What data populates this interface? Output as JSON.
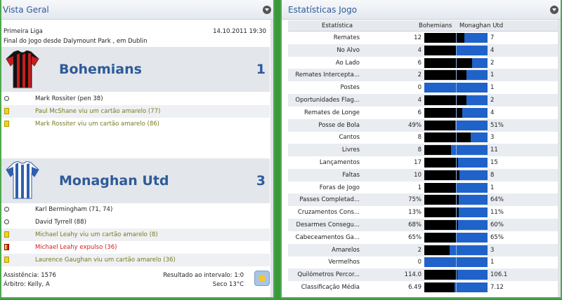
{
  "left": {
    "title": "Vista Geral",
    "competition": "Primeira Liga",
    "datetime": "14.10.2011 19:30",
    "match_status": "Final do Jogo desde Dalymount Park , em Dublin",
    "home": {
      "name": "Bohemians",
      "score": "1",
      "shirt_colors": [
        "#111111",
        "#c41e1e"
      ]
    },
    "home_events": [
      {
        "icon": "ball",
        "text": "Mark Rossiter (pen 38)",
        "color": "gray"
      },
      {
        "icon": "yellow",
        "text": "Paul McShane viu um cartão amarelo (77)",
        "color": "olive"
      },
      {
        "icon": "yellow",
        "text": "Mark Rossiter viu um cartão amarelo (86)",
        "color": "olive"
      }
    ],
    "away": {
      "name": "Monaghan Utd",
      "score": "3",
      "shirt_colors": [
        "#2e5fb0",
        "#ffffff"
      ]
    },
    "away_events": [
      {
        "icon": "ball",
        "text": "Karl Bermingham (71, 74)",
        "color": "gray"
      },
      {
        "icon": "ball",
        "text": "David Tyrrell (88)",
        "color": "gray"
      },
      {
        "icon": "yellow",
        "text": "Michael Leahy viu um cartão amarelo (8)",
        "color": "olive"
      },
      {
        "icon": "red",
        "text": "Michael Leahy expulso (36)",
        "color": "red"
      },
      {
        "icon": "yellow",
        "text": "Laurence Gaughan viu um cartão amarelo (36)",
        "color": "olive"
      }
    ],
    "attendance": "Assistência: 1576",
    "referee": "Árbitro: Kelly, A",
    "halftime": "Resultado ao intervalo: 1:0",
    "weather": "Seco 13°C"
  },
  "right": {
    "title": "Estatísticas Jogo",
    "col_stat": "Estatística",
    "col_home": "Bohemians",
    "col_away": "Monaghan Utd",
    "stats": [
      {
        "label": "Remates",
        "home": "12",
        "away": "7",
        "share": 0.63
      },
      {
        "label": "No Alvo",
        "home": "4",
        "away": "4",
        "share": 0.5
      },
      {
        "label": "Ao Lado",
        "home": "6",
        "away": "2",
        "share": 0.75
      },
      {
        "label": "Remates Intercepta...",
        "home": "2",
        "away": "1",
        "share": 0.67
      },
      {
        "label": "Postes",
        "home": "0",
        "away": "1",
        "share": 0.0
      },
      {
        "label": "Oportunidades Flag...",
        "home": "4",
        "away": "2",
        "share": 0.67
      },
      {
        "label": "Remates de Longe",
        "home": "6",
        "away": "4",
        "share": 0.6
      },
      {
        "label": "Posse de Bola",
        "home": "49%",
        "away": "51%",
        "share": 0.49
      },
      {
        "label": "Cantos",
        "home": "8",
        "away": "3",
        "share": 0.73
      },
      {
        "label": "Livres",
        "home": "8",
        "away": "11",
        "share": 0.42
      },
      {
        "label": "Lançamentos",
        "home": "17",
        "away": "15",
        "share": 0.53
      },
      {
        "label": "Faltas",
        "home": "10",
        "away": "8",
        "share": 0.56
      },
      {
        "label": "Foras de Jogo",
        "home": "1",
        "away": "1",
        "share": 0.5
      },
      {
        "label": "Passes Completad...",
        "home": "75%",
        "away": "64%",
        "share": 0.54
      },
      {
        "label": "Cruzamentos Cons...",
        "home": "13%",
        "away": "11%",
        "share": 0.54
      },
      {
        "label": "Desarmes Consegu...",
        "home": "68%",
        "away": "60%",
        "share": 0.53
      },
      {
        "label": "Cabeceamentos Ga...",
        "home": "65%",
        "away": "65%",
        "share": 0.5
      },
      {
        "label": "Amarelos",
        "home": "2",
        "away": "3",
        "share": 0.4
      },
      {
        "label": "Vermelhos",
        "home": "0",
        "away": "1",
        "share": 0.0
      },
      {
        "label": "Quilómetros Percor...",
        "home": "114.0",
        "away": "106.1",
        "share": 0.52
      },
      {
        "label": "Classificação Média",
        "home": "6.49",
        "away": "7.12",
        "share": 0.48
      }
    ]
  }
}
